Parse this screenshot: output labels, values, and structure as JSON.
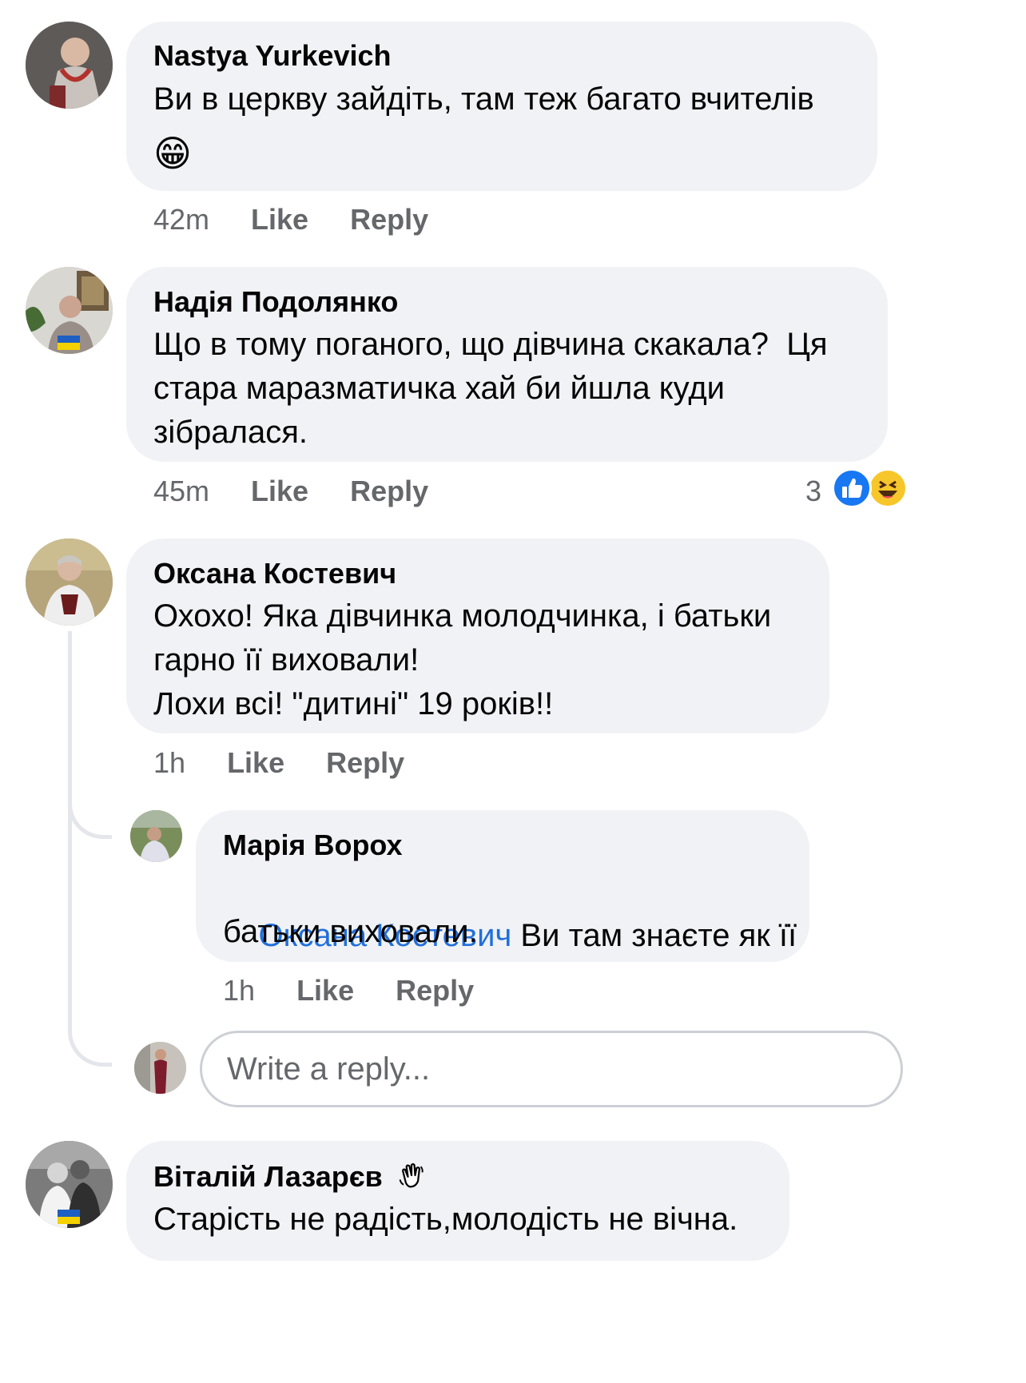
{
  "comments": [
    {
      "author": "Nastya Yurkevich",
      "text": "Ви в церкву зайдіть, там теж багато вчителів",
      "emoji": "😁",
      "time": "42m",
      "like": "Like",
      "reply": "Reply"
    },
    {
      "author": "Надія Подолянко",
      "text_line1": "Що в тому поганого, що дівчина скакала?  Ця",
      "text_line2": "стара маразматичка хай би йшла куди",
      "text_line3": "зібралася.",
      "time": "45m",
      "like": "Like",
      "reply": "Reply",
      "reaction_count": "3",
      "reaction_icons": [
        "like-reaction-icon",
        "haha-reaction-icon"
      ]
    },
    {
      "author": "Оксана Костевич",
      "text_line1": "Охохо! Яка дівчинка молодчинка, і батьки",
      "text_line2": "гарно її виховали!",
      "text_line3": "Лохи всі! \"дитині\" 19 років!!",
      "time": "1h",
      "like": "Like",
      "reply": "Reply"
    },
    {
      "author": "Марія Ворох",
      "mention": "Оксана Костевич",
      "text_line1_rest": " Ви там знаєте як її",
      "text_line2": "батьки виховали.",
      "time": "1h",
      "like": "Like",
      "reply": "Reply"
    },
    {
      "author": "Віталій Лазарєв",
      "badge_icon": "waving-hand-icon",
      "text": "Старість не радість,молодість не вічна."
    }
  ],
  "reply_input": {
    "placeholder": "Write a reply..."
  },
  "colors": {
    "bubble": "#f0f2f5",
    "mention": "#216fdb",
    "meta": "#65676b",
    "like_blue": "#1877f2",
    "haha_yellow": "#f7c62a"
  }
}
